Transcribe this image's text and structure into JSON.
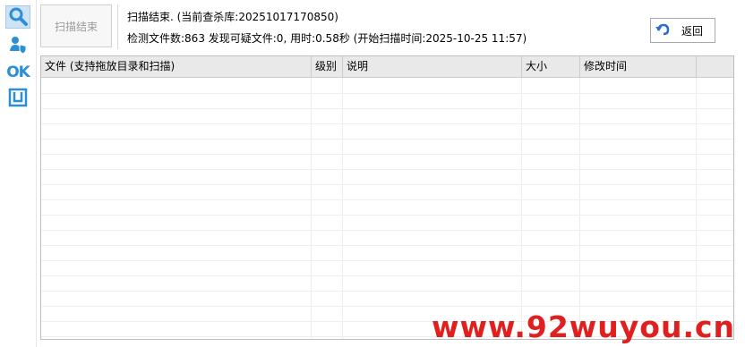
{
  "sidebar": {
    "items": [
      {
        "name": "scan",
        "icon": "magnifier-icon",
        "active": true
      },
      {
        "name": "quarantine",
        "icon": "user-shield-icon",
        "active": false
      },
      {
        "name": "trust",
        "icon": "ok-icon",
        "label": "OK",
        "active": false
      },
      {
        "name": "other",
        "icon": "square-bracket-icon",
        "active": false
      }
    ]
  },
  "toolbar": {
    "scan_button_label": "扫描结束",
    "back_button_label": "返回"
  },
  "status": {
    "line1": "扫描结束. (当前查杀库:20251017170850)",
    "line2": "检测文件数:863 发现可疑文件:0, 用时:0.58秒 (开始扫描时间:2025-10-25 11:57)"
  },
  "table": {
    "columns": [
      {
        "label": "文件 (支持拖放目录和扫描)"
      },
      {
        "label": "级别"
      },
      {
        "label": "说明"
      },
      {
        "label": "大小"
      },
      {
        "label": "修改时间"
      },
      {
        "label": ""
      }
    ],
    "rows": []
  },
  "watermark": "www.92wuyou.cn",
  "colors": {
    "accent": "#2a8fd4",
    "watermark": "#e01f1f",
    "header_bg": "#e9e9e9"
  }
}
